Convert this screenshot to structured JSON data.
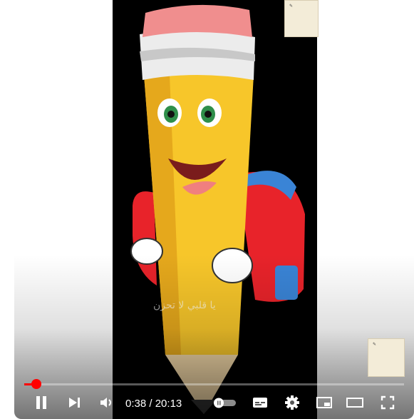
{
  "player": {
    "time_current": "0:38",
    "time_separator": " / ",
    "time_total": "20:13",
    "progress_fraction": 0.031,
    "buffered_fraction": 0.04,
    "autoplay_on": false,
    "accent_color": "#ff0000"
  },
  "video": {
    "overlay_text": "يا قلبي لا تحزن"
  },
  "icons": {
    "play_pause": "pause-icon",
    "next": "next-icon",
    "volume": "volume-icon",
    "autoplay": "autoplay-toggle-icon",
    "captions": "captions-icon",
    "settings": "gear-icon",
    "miniplayer": "miniplayer-icon",
    "theater": "theater-mode-icon",
    "fullscreen": "fullscreen-icon"
  }
}
